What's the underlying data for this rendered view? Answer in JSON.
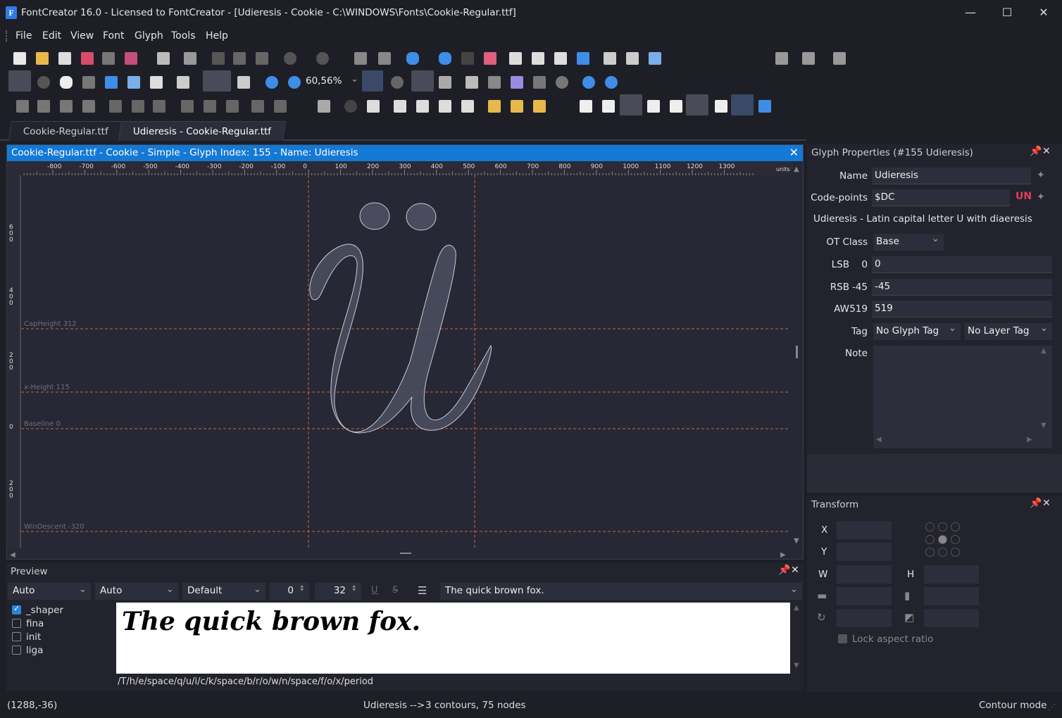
{
  "window": {
    "title": "FontCreator 16.0 - Licensed to FontCreator - [Udieresis - Cookie - C:\\WINDOWS\\Fonts\\Cookie-Regular.ttf]",
    "minimize": "—",
    "maximize": "☐",
    "close": "✕"
  },
  "menu": [
    "File",
    "Edit",
    "View",
    "Font",
    "Glyph",
    "Tools",
    "Help"
  ],
  "zoom": "60,56%",
  "tabs": [
    {
      "label": "Cookie-Regular.ttf",
      "active": false
    },
    {
      "label": "Udieresis - Cookie-Regular.ttf",
      "active": true
    }
  ],
  "glyph_window": {
    "header": "Cookie-Regular.ttf - Cookie - Simple - Glyph Index: 155 - Name: Udieresis",
    "close": "✕",
    "ruler_ticks": [
      "-800",
      "-700",
      "-600",
      "-500",
      "-400",
      "-300",
      "-200",
      "-100",
      "0",
      "100",
      "200",
      "300",
      "400",
      "500",
      "600",
      "700",
      "800",
      "900",
      "1000",
      "1100",
      "1200",
      "1300"
    ],
    "ruler_units": "units",
    "vruler_ticks": [
      "600",
      "400",
      "200",
      "0",
      "200"
    ],
    "guides": [
      {
        "label": "CapHeight 312"
      },
      {
        "label": "x-Height 115"
      },
      {
        "label": "Baseline 0"
      },
      {
        "label": "WinDescent -320"
      }
    ],
    "glyph_color": "#c9cbd6",
    "guide_color": "#d9622b"
  },
  "properties": {
    "title": "Glyph Properties (#155 Udieresis)",
    "name_label": "Name",
    "name_value": "Udieresis",
    "codepoints_label": "Code-points",
    "codepoints_value": "$DC",
    "unicode_badge": "UN",
    "description": "Udieresis - Latin capital letter U with diaeresis",
    "otclass_label": "OT Class",
    "otclass_value": "Base",
    "lsb_label": "LSB",
    "lsb_current": "0",
    "lsb_value": "0",
    "rsb_label": "RSB",
    "rsb_current": "-45",
    "rsb_value": "-45",
    "aw_label": "AW",
    "aw_current": "519",
    "aw_value": "519",
    "tag_label": "Tag",
    "glyph_tag": "No Glyph Tag",
    "layer_tag": "No Layer Tag",
    "note_label": "Note"
  },
  "transform": {
    "title": "Transform",
    "x_label": "X",
    "y_label": "Y",
    "w_label": "W",
    "h_label": "H",
    "lock_label": "Lock aspect ratio"
  },
  "preview": {
    "title": "Preview",
    "combo1": "Auto",
    "combo2": "Auto",
    "combo3": "Default",
    "spin1": "0",
    "spin2": "32",
    "text_combo": "The quick brown fox.",
    "features": [
      {
        "name": "_shaper",
        "checked": true
      },
      {
        "name": "fina",
        "checked": false
      },
      {
        "name": "init",
        "checked": false
      },
      {
        "name": "liga",
        "checked": false
      }
    ],
    "sample_text": "The quick brown fox.",
    "glyph_string": "/T/h/e/space/q/u/i/c/k/space/b/r/o/w/n/space/f/o/x/period"
  },
  "status": {
    "coords": "(1288,-36)",
    "glyph_info": "Udieresis -->",
    "contours": "3 contours, 75 nodes",
    "mode": "Contour mode"
  }
}
